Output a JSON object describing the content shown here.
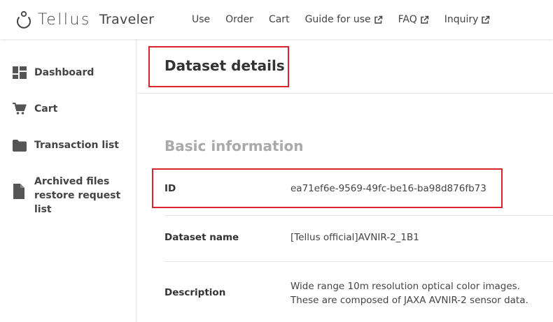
{
  "header": {
    "logo_text": "Tellus",
    "logo_sub": "Traveler",
    "nav": [
      {
        "label": "Use",
        "external": false
      },
      {
        "label": "Order",
        "external": false
      },
      {
        "label": "Cart",
        "external": false
      },
      {
        "label": "Guide for use",
        "external": true
      },
      {
        "label": "FAQ",
        "external": true
      },
      {
        "label": "Inquiry",
        "external": true
      }
    ]
  },
  "sidebar": {
    "items": [
      {
        "label": "Dashboard",
        "icon": "dashboard-icon"
      },
      {
        "label": "Cart",
        "icon": "cart-icon"
      },
      {
        "label": "Transaction list",
        "icon": "folder-icon"
      },
      {
        "label_lines": [
          "Archived files",
          "restore request",
          "list"
        ],
        "icon": "file-icon"
      }
    ]
  },
  "main": {
    "page_title": "Dataset details",
    "section_title": "Basic information",
    "rows": [
      {
        "label": "ID",
        "value": "ea71ef6e-9569-49fc-be16-ba98d876fb73"
      },
      {
        "label": "Dataset name",
        "value": "[Tellus official]AVNIR-2_1B1"
      },
      {
        "label": "Description",
        "value_lines": [
          "Wide range 10m resolution optical color images.",
          "These are composed of JAXA AVNIR-2 sensor data."
        ]
      }
    ]
  },
  "colors": {
    "highlight": "#d9232e",
    "text": "#333333",
    "muted": "#aaaaaa"
  }
}
